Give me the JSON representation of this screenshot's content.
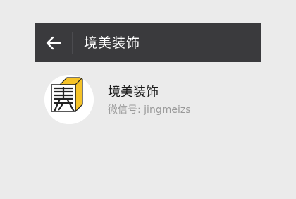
{
  "header": {
    "title": "境美装饰",
    "back_icon": "back-arrow-icon"
  },
  "account": {
    "name": "境美装饰",
    "wechat_id": "微信号: jingmeizs",
    "avatar_icon": "jingmei-logo-icon"
  },
  "colors": {
    "background": "#ebebeb",
    "header_bg": "#3a3a3d",
    "logo_yellow": "#f6c327",
    "text_primary": "#1a1a1a",
    "text_secondary": "#9a9a9a"
  }
}
